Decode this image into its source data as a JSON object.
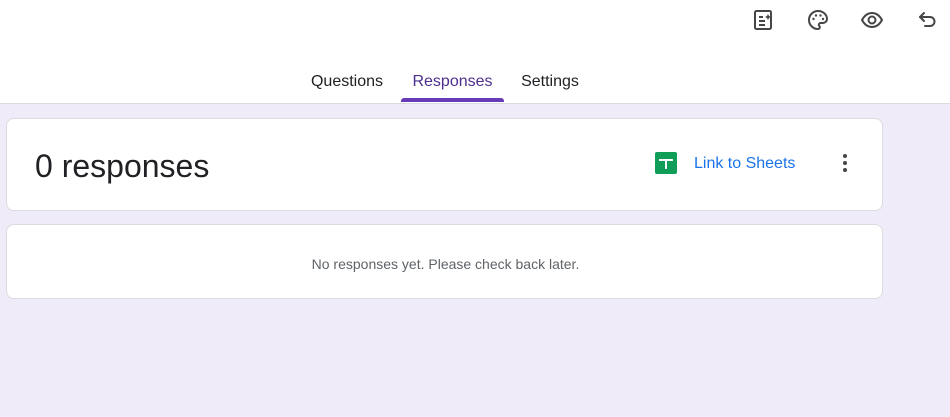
{
  "toolbar": {
    "icons": [
      "customize-form-icon",
      "palette-icon",
      "preview-eye-icon",
      "undo-icon"
    ]
  },
  "tabs": [
    {
      "label": "Questions",
      "active": false
    },
    {
      "label": "Responses",
      "active": true
    },
    {
      "label": "Settings",
      "active": false
    }
  ],
  "summary": {
    "count_label": "0 responses",
    "link_label": "Link to Sheets",
    "sheets_icon": "google-sheets-icon",
    "more_icon": "more-vert-icon"
  },
  "empty_state": {
    "message": "No responses yet. Please check back later."
  },
  "colors": {
    "accent": "#673ab7",
    "link": "#1a73e8",
    "sheets_green": "#0f9d58",
    "page_background": "#f0ebf8"
  }
}
